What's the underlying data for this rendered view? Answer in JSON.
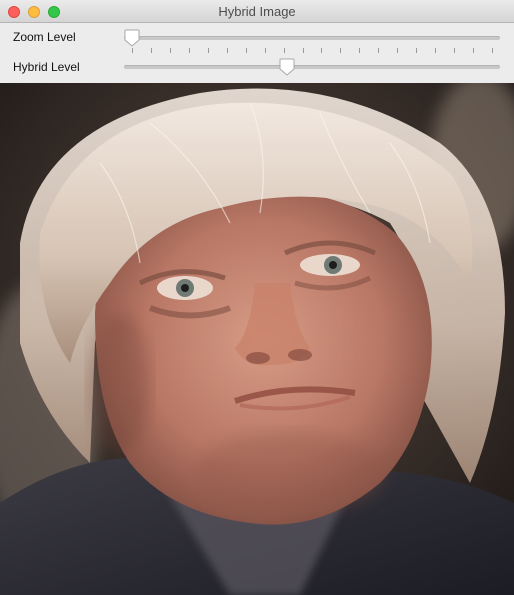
{
  "window": {
    "title": "Hybrid Image"
  },
  "controls": {
    "zoom": {
      "label": "Zoom Level",
      "value_fraction": 0.0,
      "tick_count": 20
    },
    "hybrid": {
      "label": "Hybrid Level",
      "value_fraction": 0.43,
      "tick_count": 0
    }
  },
  "image": {
    "description_icon": "photo-icon"
  }
}
